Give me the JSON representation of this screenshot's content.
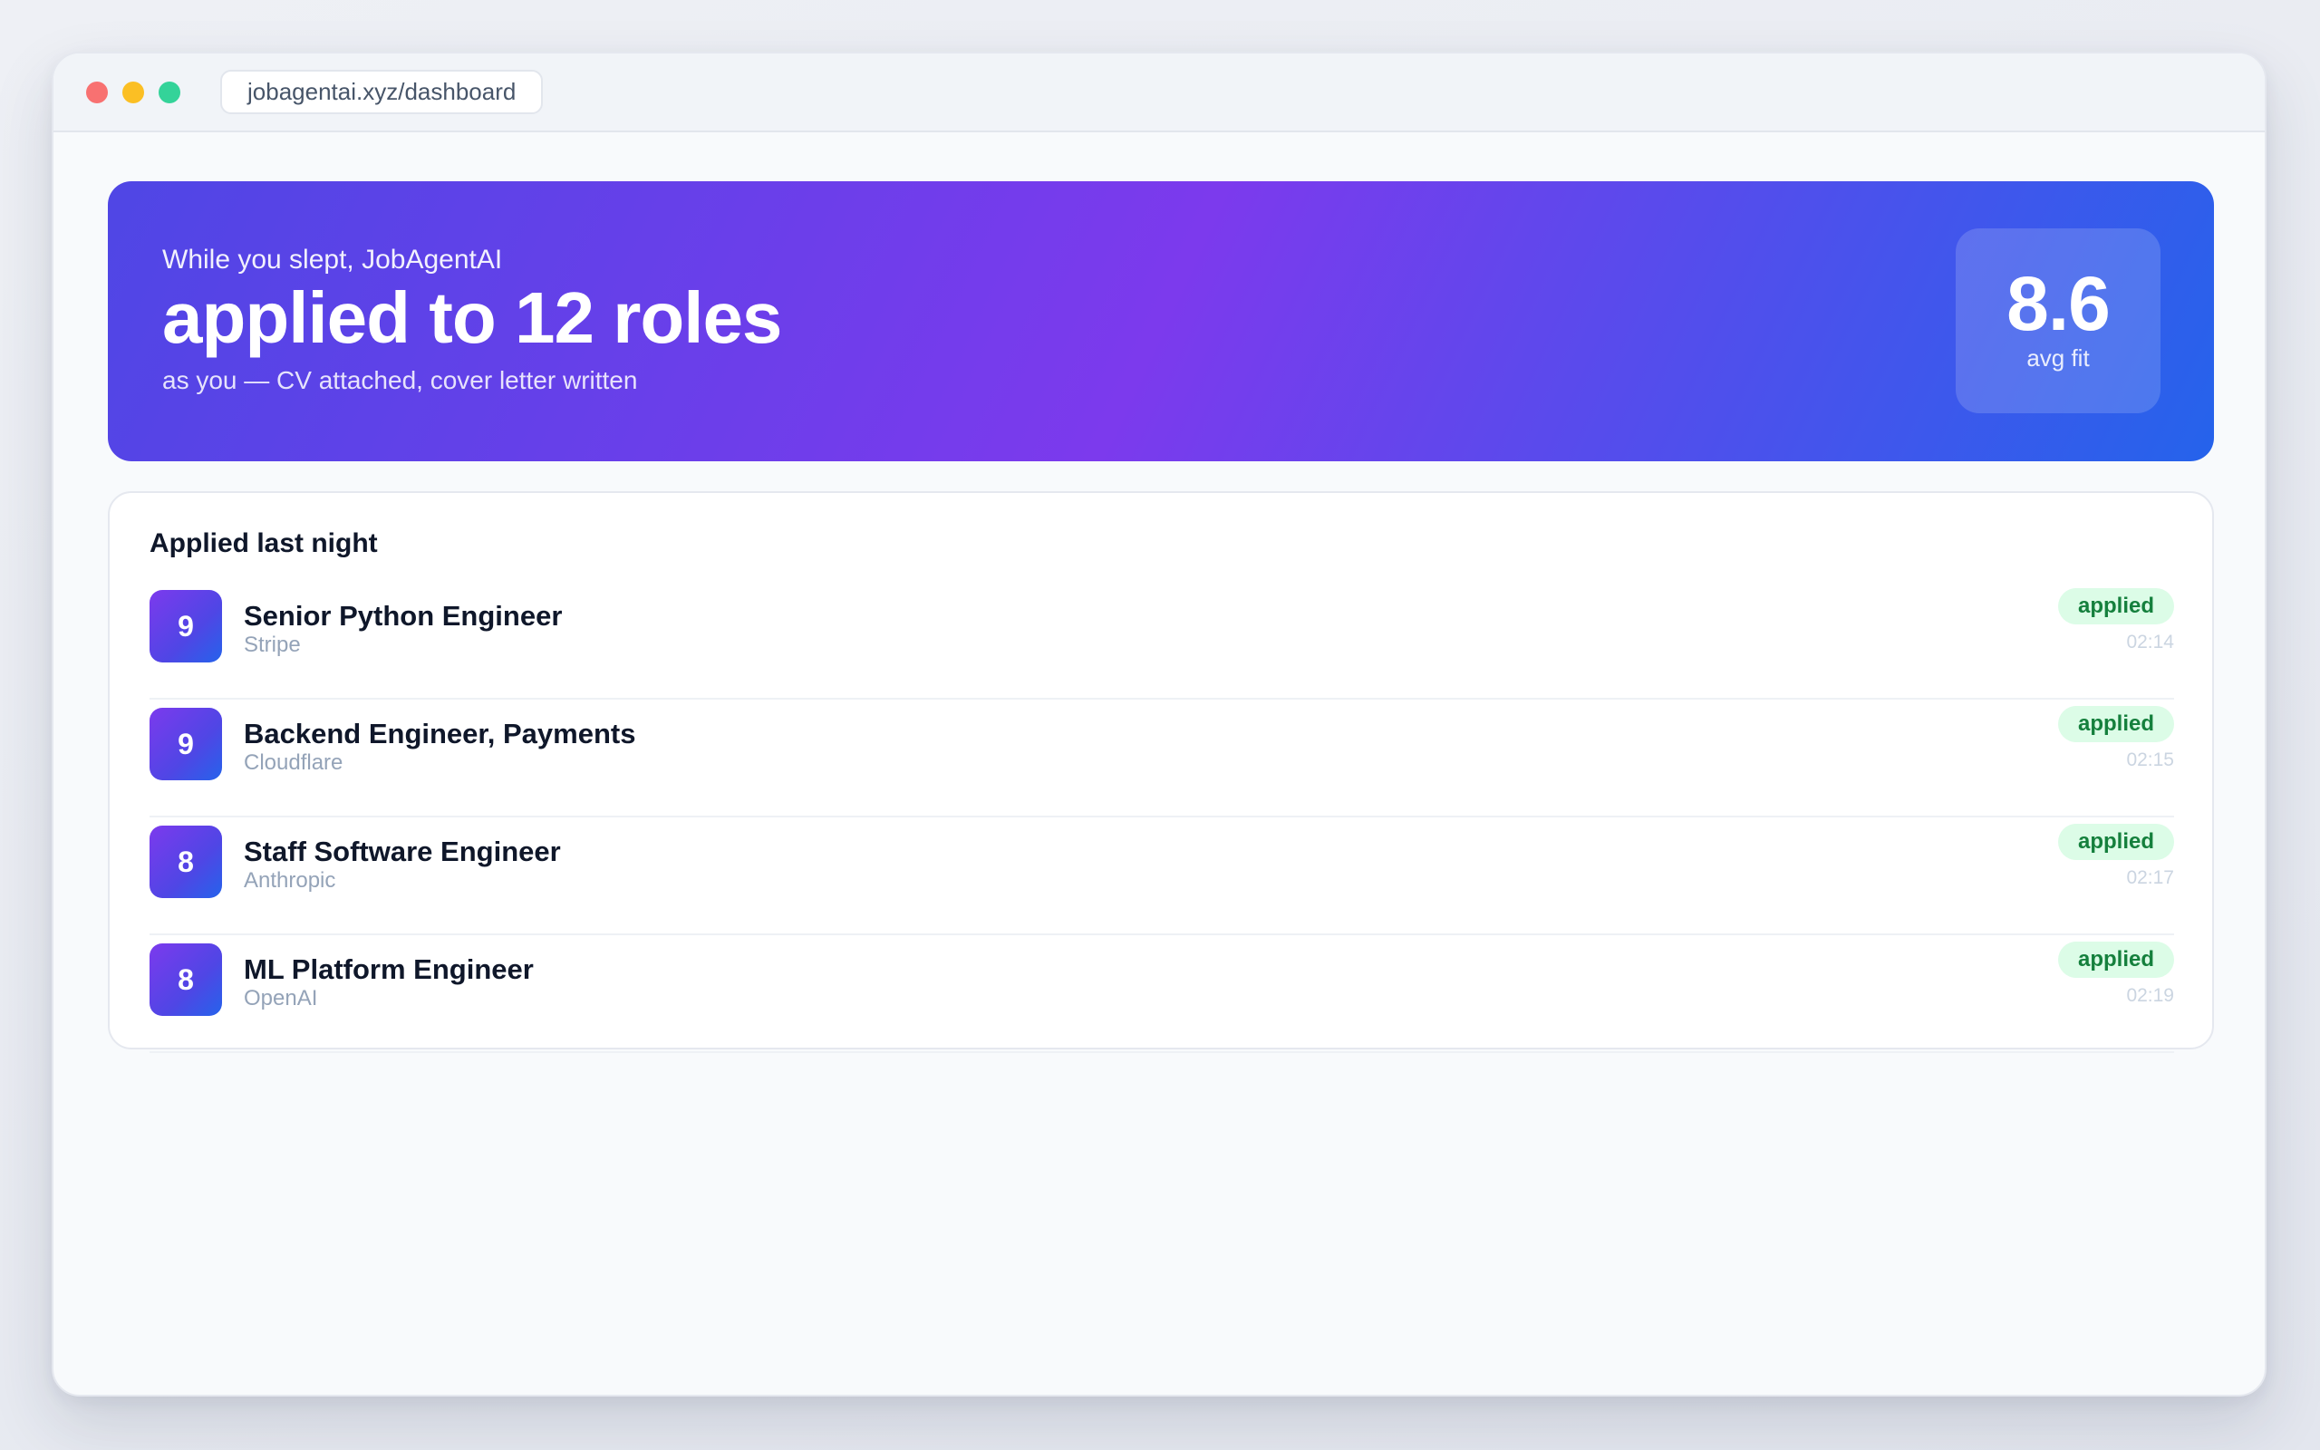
{
  "browser": {
    "url": "jobagentai.xyz/dashboard"
  },
  "hero": {
    "kicker": "While you slept, JobAgentAI",
    "title": "applied to 12 roles",
    "subtitle": "as you — CV attached, cover letter written",
    "avg_fit_value": "8.6",
    "avg_fit_label": "avg fit"
  },
  "applied": {
    "title": "Applied last night",
    "items": [
      {
        "score": "9",
        "role": "Senior Python Engineer",
        "company": "Stripe",
        "status": "applied",
        "time": "02:14"
      },
      {
        "score": "9",
        "role": "Backend Engineer, Payments",
        "company": "Cloudflare",
        "status": "applied",
        "time": "02:15"
      },
      {
        "score": "8",
        "role": "Staff Software Engineer",
        "company": "Anthropic",
        "status": "applied",
        "time": "02:17"
      },
      {
        "score": "8",
        "role": "ML Platform Engineer",
        "company": "OpenAI",
        "status": "applied",
        "time": "02:19"
      }
    ]
  },
  "colors": {
    "hero_gradient_start": "#4f46e5",
    "hero_gradient_mid": "#7c3aed",
    "hero_gradient_end": "#2563eb",
    "status_applied_bg": "#dcfce7",
    "status_applied_text": "#15803d",
    "traffic_red": "#f87171",
    "traffic_yellow": "#fbbf24",
    "traffic_green": "#34d399"
  }
}
